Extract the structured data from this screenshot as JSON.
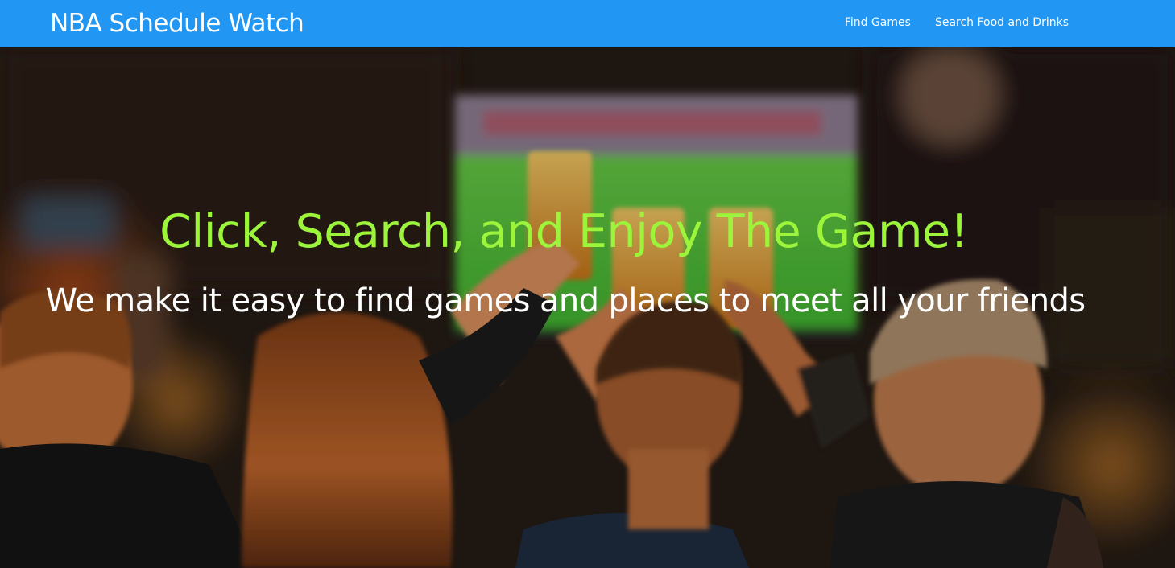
{
  "navbar": {
    "brand": "NBA Schedule Watch",
    "links": [
      {
        "label": "Find Games"
      },
      {
        "label": "Search Food and Drinks"
      }
    ],
    "color": "#2196f3"
  },
  "hero": {
    "title": "Click, Search, and Enjoy The Game!",
    "subtitle": "We make it easy to find games and places to meet all your friends",
    "title_color": "#9cf53b",
    "subtitle_color": "#ffffff",
    "background_image": "people-toasting-beers-watching-game-at-sports-bar"
  }
}
